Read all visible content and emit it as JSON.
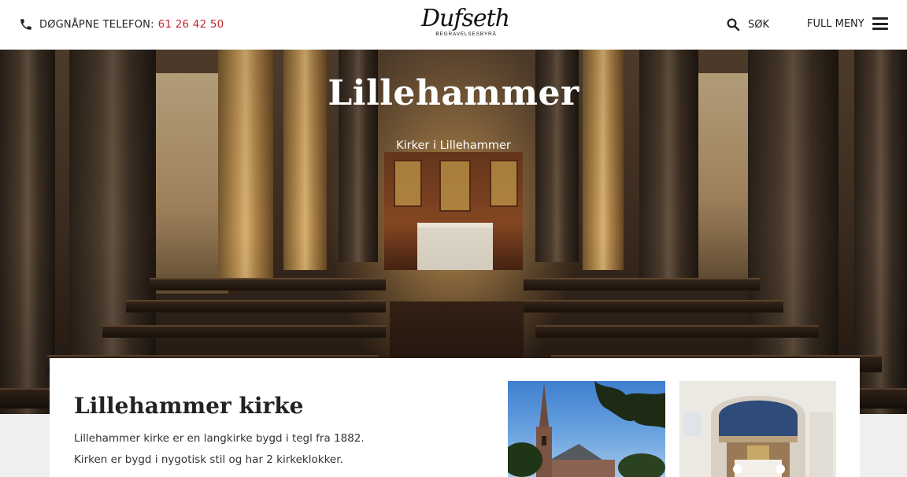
{
  "header": {
    "phone_label": "DØGNÅPNE TELEFON:",
    "phone_number": "61 26 42 50",
    "logo_script": "Dufseth",
    "logo_sub": "BEGRAVELSESBYRÅ",
    "search_label": "SØK",
    "menu_label": "FULL MENY"
  },
  "hero": {
    "title": "Lillehammer",
    "subtitle": "Kirker i Lillehammer"
  },
  "content": {
    "title": "Lillehammer kirke",
    "paragraphs": [
      "Lillehammer kirke er en langkirke bygd i tegl fra 1882.",
      "Kirken er bygd i nygotisk stil og har 2 kirkeklokker."
    ]
  },
  "colors": {
    "accent": "#c0272d",
    "text": "#222222",
    "background": "#efefef"
  },
  "icons": {
    "phone": "phone-icon",
    "search": "search-icon",
    "menu": "hamburger-icon"
  }
}
